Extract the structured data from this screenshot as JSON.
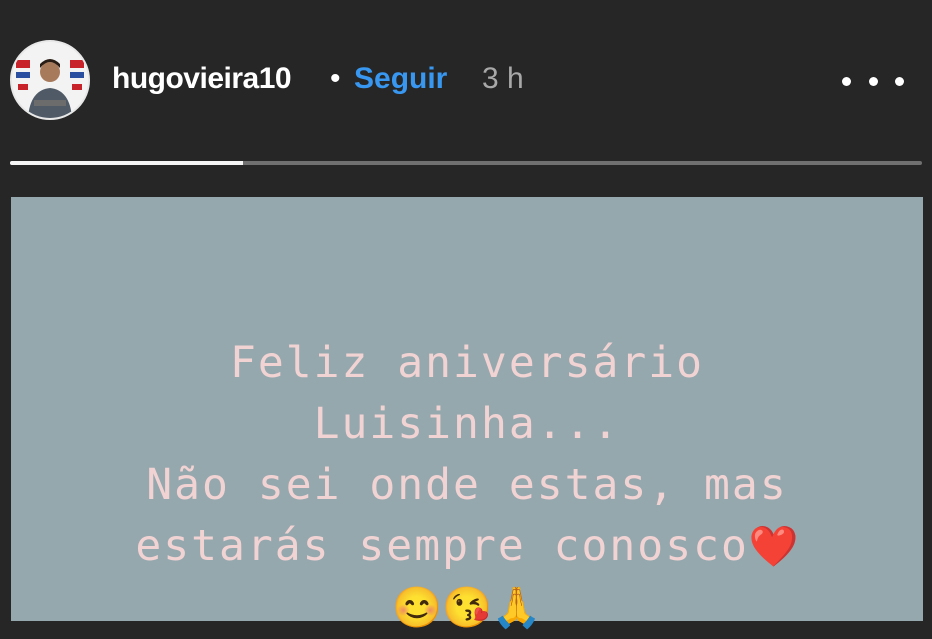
{
  "header": {
    "username": "hugovieira10",
    "separator": "•",
    "follow_label": "Seguir",
    "time_ago": "3 h",
    "more_icon": "more-horizontal-icon"
  },
  "progress": {
    "fraction": 0.255
  },
  "story": {
    "background_color": "#95a8ae",
    "text_color": "#f2d3d3",
    "lines": [
      "Feliz aniversário",
      "Luisinha...",
      "Não sei onde estas, mas",
      "estarás sempre conosco"
    ],
    "heart_emoji": "❤️",
    "emoji_line": "😊😘🙏"
  }
}
